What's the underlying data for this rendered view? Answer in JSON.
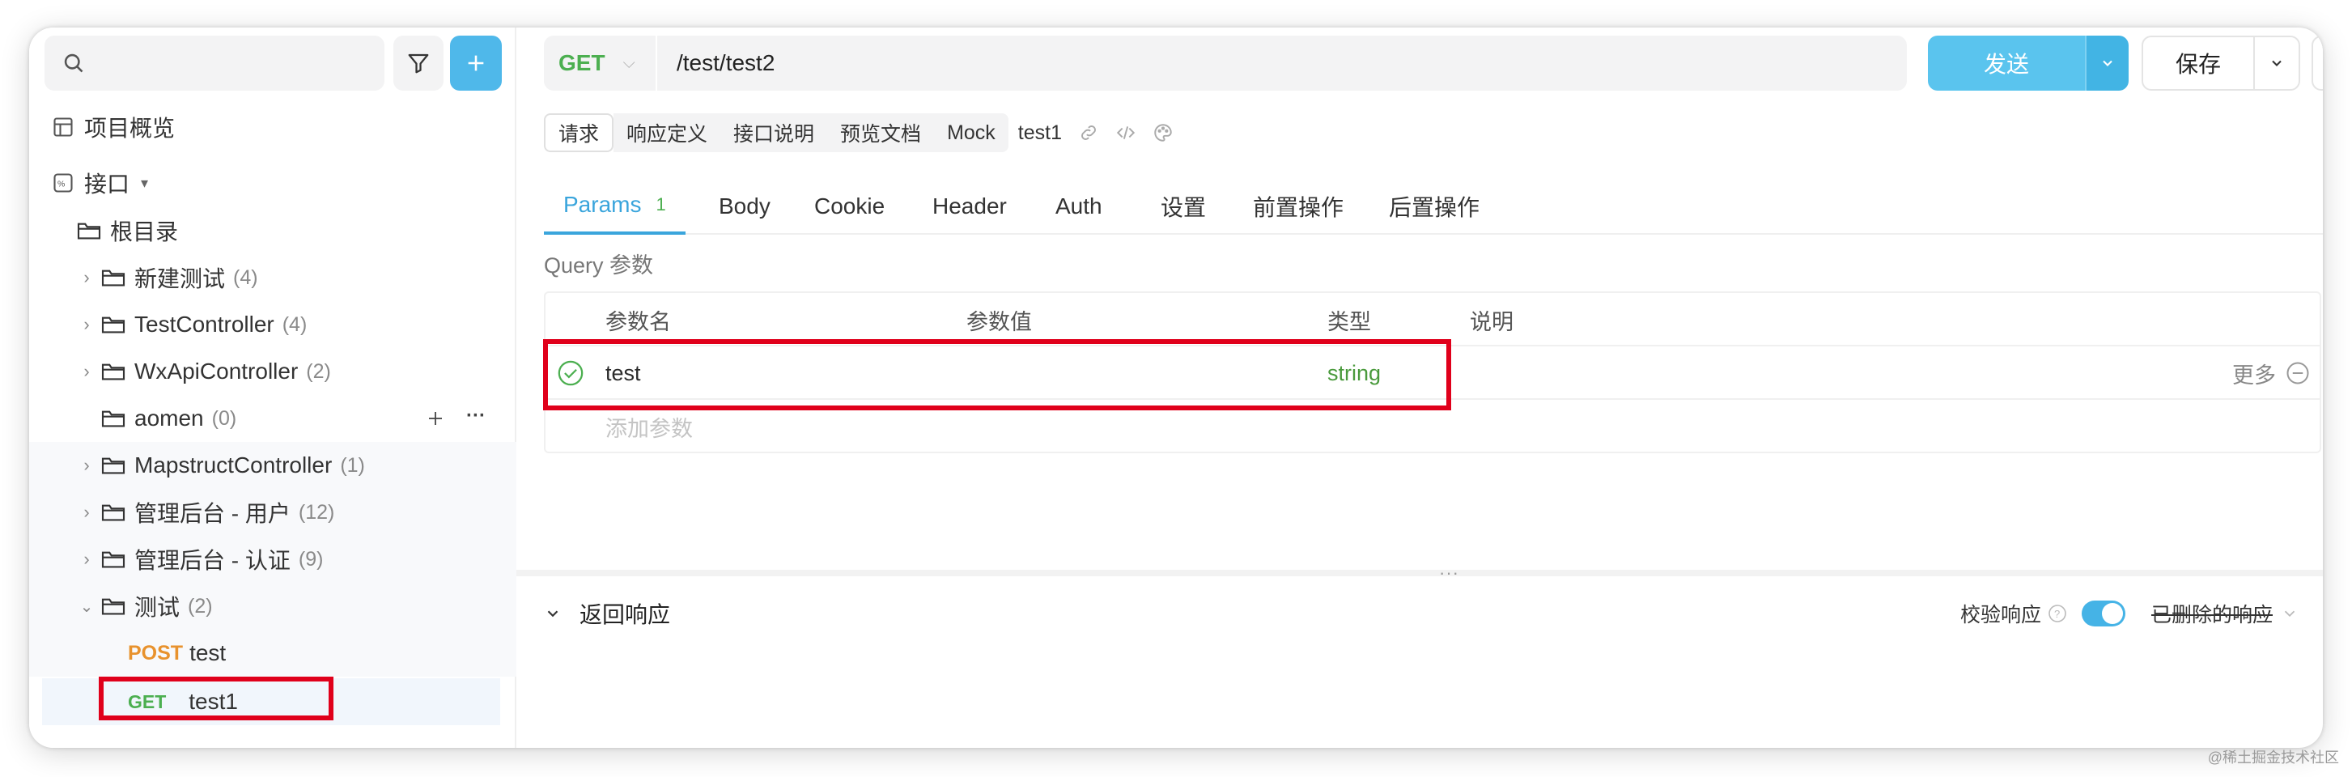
{
  "sidebar": {
    "search": {
      "placeholder": ""
    },
    "overview_label": "项目概览",
    "api_label": "接口",
    "api_caret": "▾",
    "root_label": "根目录",
    "folders": [
      {
        "name": "新建测试",
        "count": "(4)"
      },
      {
        "name": "TestController",
        "count": "(4)"
      },
      {
        "name": "WxApiController",
        "count": "(2)"
      },
      {
        "name": "aomen",
        "count": "(0)"
      },
      {
        "name": "MapstructController",
        "count": "(1)"
      },
      {
        "name": "管理后台 - 用户",
        "count": "(12)"
      },
      {
        "name": "管理后台 - 认证",
        "count": "(9)"
      },
      {
        "name": "测试",
        "count": "(2)"
      }
    ],
    "endpoints": [
      {
        "method": "POST",
        "name": "test"
      },
      {
        "method": "GET",
        "name": "test1"
      }
    ]
  },
  "request": {
    "method": "GET",
    "url": "/test/test2",
    "send_label": "发送",
    "save_label": "保存"
  },
  "subtabs": [
    "请求",
    "响应定义",
    "接口说明",
    "预览文档",
    "Mock"
  ],
  "endpoint_name": "test1",
  "param_tabs": [
    {
      "label": "Params",
      "badge": "1"
    },
    {
      "label": "Body"
    },
    {
      "label": "Cookie"
    },
    {
      "label": "Header"
    },
    {
      "label": "Auth"
    },
    {
      "label": "设置"
    },
    {
      "label": "前置操作"
    },
    {
      "label": "后置操作"
    }
  ],
  "query": {
    "title": "Query 参数",
    "columns": [
      "参数名",
      "参数值",
      "类型",
      "说明"
    ],
    "rows": [
      {
        "name": "test",
        "value": "",
        "type": "string",
        "desc": "",
        "more": "更多"
      }
    ],
    "add_placeholder": "添加参数"
  },
  "response": {
    "title": "返回响应",
    "validate_label": "校验响应",
    "validate_on": true,
    "deleted_label": "已删除的响应"
  },
  "watermark": "@稀土掘金技术社区",
  "colors": {
    "accent": "#3aa5dc",
    "get": "#4caf50",
    "post": "#e8922d",
    "highlight_box": "#e0001b"
  }
}
